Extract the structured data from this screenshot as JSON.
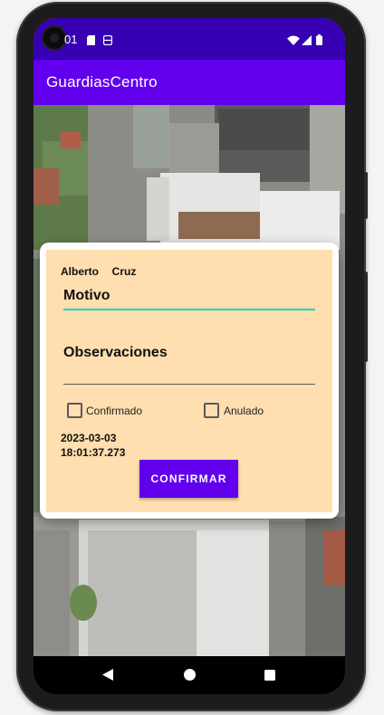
{
  "status_bar": {
    "time": "01",
    "icons": [
      "sd-card-icon",
      "storage-icon",
      "wifi-icon",
      "signal-icon",
      "battery-icon"
    ]
  },
  "app_bar": {
    "title": "GuardiasCentro"
  },
  "dialog": {
    "person_name": "Alberto  Cruz",
    "motivo_label": "Motivo",
    "observaciones_label": "Observaciones",
    "checkboxes": [
      {
        "label": "Confirmado",
        "checked": false
      },
      {
        "label": "Anulado",
        "checked": false
      }
    ],
    "date": "2023-03-03",
    "time": "18:01:37.273",
    "confirm_button": "CONFIRMAR"
  },
  "nav_bar": {
    "icons": [
      "back-icon",
      "home-icon",
      "recents-icon"
    ]
  },
  "colors": {
    "status_bar": "#3700b3",
    "app_bar": "#6200ee",
    "dialog_background": "#ffdeaf",
    "accent_teal": "#03dac5",
    "button": "#6200ee"
  }
}
